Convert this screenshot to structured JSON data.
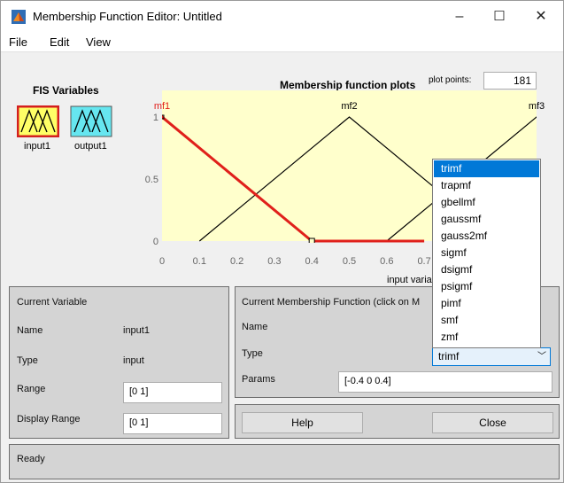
{
  "window": {
    "title": "Membership Function Editor: Untitled",
    "minimize": "–",
    "maximize": "☐",
    "close": "✕"
  },
  "menu": [
    "File",
    "Edit",
    "View"
  ],
  "fis": {
    "label": "FIS Variables",
    "variables": [
      {
        "name": "input1",
        "selected": true
      },
      {
        "name": "output1",
        "selected": false
      }
    ]
  },
  "plot": {
    "title": "Membership function plots",
    "plot_points_label": "plot points:",
    "plot_points_value": "181",
    "mf_labels": [
      "mf1",
      "mf2",
      "mf3"
    ],
    "y_ticks": [
      "0",
      "0.5",
      "1"
    ],
    "x_ticks": [
      "0",
      "0.1",
      "0.2",
      "0.3",
      "0.4",
      "0.5",
      "0.6",
      "0.7"
    ],
    "xlabel": "input variable \"input1\""
  },
  "chart_data": {
    "type": "line",
    "xlim": [
      0,
      1
    ],
    "ylim": [
      0,
      1
    ],
    "series": [
      {
        "name": "mf1",
        "x": [
          -0.4,
          0,
          0.4
        ],
        "y": [
          0,
          1,
          0
        ],
        "highlight": true
      },
      {
        "name": "mf2",
        "x": [
          0.1,
          0.5,
          0.9
        ],
        "y": [
          0,
          1,
          0
        ],
        "highlight": false
      },
      {
        "name": "mf3",
        "x": [
          0.6,
          1,
          1.4
        ],
        "y": [
          0,
          1,
          0
        ],
        "highlight": false
      }
    ],
    "colors": {
      "selected": "#e0201b",
      "normal": "#000000",
      "background": "#ffffcc"
    }
  },
  "current_variable": {
    "title": "Current Variable",
    "name_label": "Name",
    "name_value": "input1",
    "type_label": "Type",
    "type_value": "input",
    "range_label": "Range",
    "range_value": "[0 1]",
    "display_range_label": "Display Range",
    "display_range_value": "[0 1]"
  },
  "current_mf": {
    "title": "Current Membership Function (click on M",
    "name_label": "Name",
    "type_label": "Type",
    "type_value": "trimf",
    "params_label": "Params",
    "params_value": "[-0.4 0 0.4]"
  },
  "type_options": [
    "trimf",
    "trapmf",
    "gbellmf",
    "gaussmf",
    "gauss2mf",
    "sigmf",
    "dsigmf",
    "psigmf",
    "pimf",
    "smf",
    "zmf"
  ],
  "buttons": {
    "help": "Help",
    "close": "Close"
  },
  "status": "Ready"
}
